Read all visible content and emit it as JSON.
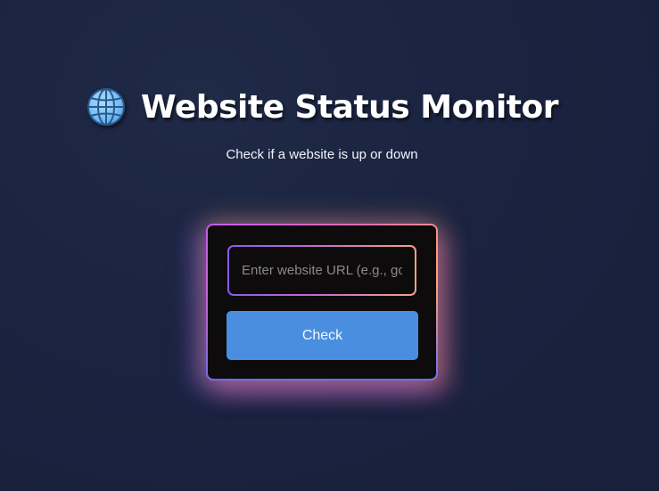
{
  "header": {
    "icon": "globe-icon",
    "title": "Website Status Monitor",
    "subtitle": "Check if a website is up or down"
  },
  "form": {
    "url_input": {
      "value": "",
      "placeholder": "Enter website URL (e.g., google.com)"
    },
    "check_label": "Check"
  },
  "colors": {
    "background": "#1a2340",
    "card": "#0d0b0c",
    "button": "#4a8ee0",
    "border_gradient": [
      "#c15cf0",
      "#e86ab0",
      "#f7b26a"
    ]
  }
}
